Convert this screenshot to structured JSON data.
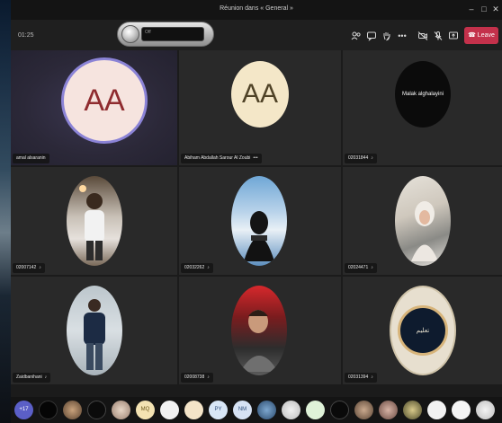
{
  "window": {
    "title": "Réunion dans « General »"
  },
  "toolbar": {
    "timer": "01:25",
    "recorder_label": "Off",
    "leave_label": "Leave"
  },
  "tiles": [
    {
      "name": "amal alsaranin",
      "initials": "AA",
      "avatar_bg": "#f6e4df",
      "initials_color": "#8f2b2f"
    },
    {
      "name": "Abiham Abdallah Sarour Al Zoubi",
      "initials": "AA",
      "avatar_bg": "#f4e7c8",
      "initials_color": "#4f4226"
    },
    {
      "name": "02031844",
      "avatar_text": "Malak alghalayini",
      "avatar_bg": "#0b0b0b"
    },
    {
      "name": "02007142"
    },
    {
      "name": "02032262"
    },
    {
      "name": "02024471"
    },
    {
      "name": "Zaidbanihani"
    },
    {
      "name": "02008738"
    },
    {
      "name": "02031394",
      "avatar_text": "تعليم"
    }
  ],
  "bottom_participants": [
    {
      "label": "+17"
    },
    {
      "label": ""
    },
    {
      "label": ""
    },
    {
      "label": ""
    },
    {
      "label": ""
    },
    {
      "label": "MQ"
    },
    {
      "label": ""
    },
    {
      "label": ""
    },
    {
      "label": "PY"
    },
    {
      "label": "NM"
    },
    {
      "label": ""
    },
    {
      "label": ""
    },
    {
      "label": ""
    },
    {
      "label": ""
    },
    {
      "label": ""
    },
    {
      "label": ""
    },
    {
      "label": ""
    },
    {
      "label": ""
    },
    {
      "label": ""
    },
    {
      "label": ""
    }
  ]
}
